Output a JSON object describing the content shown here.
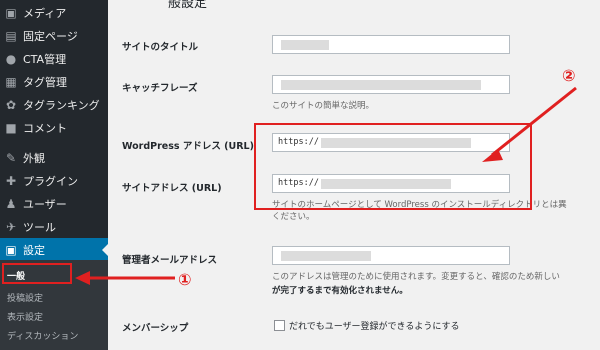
{
  "sidebar": {
    "items": [
      {
        "icon": "media-icon",
        "glyph": "▣",
        "label": "メディア"
      },
      {
        "icon": "page-icon",
        "glyph": "▤",
        "label": "固定ページ"
      },
      {
        "icon": "lightbulb-icon",
        "glyph": "●",
        "label": "CTA管理"
      },
      {
        "icon": "tag-icon",
        "glyph": "▦",
        "label": "タグ管理"
      },
      {
        "icon": "ranking-icon",
        "glyph": "✿",
        "label": "タグランキング"
      },
      {
        "icon": "comment-icon",
        "glyph": "■",
        "label": "コメント"
      },
      {
        "icon": "appearance-icon",
        "glyph": "✎",
        "label": "外観"
      },
      {
        "icon": "plugin-icon",
        "glyph": "✚",
        "label": "プラグイン"
      },
      {
        "icon": "users-icon",
        "glyph": "♟",
        "label": "ユーザー"
      },
      {
        "icon": "tools-icon",
        "glyph": "✈",
        "label": "ツール"
      },
      {
        "icon": "settings-icon",
        "glyph": "▣",
        "label": "設定"
      }
    ],
    "submenu": [
      {
        "label": "一般"
      },
      {
        "label": "投稿設定"
      },
      {
        "label": "表示設定"
      },
      {
        "label": "ディスカッション"
      }
    ]
  },
  "main": {
    "heading": "般設定",
    "site_title_label": "サイトのタイトル",
    "tagline_label": "キャッチフレーズ",
    "tagline_desc": "このサイトの簡単な説明。",
    "wp_address_label": "WordPress アドレス (URL)",
    "wp_address_value": "https://",
    "site_address_label": "サイトアドレス (URL)",
    "site_address_value": "https://",
    "site_address_desc_1": "サイトのホームページとして WordPress のインストールディレクトリとは異",
    "site_address_desc_2": "ください。",
    "admin_email_label": "管理者メールアドレス",
    "admin_email_desc_1": "このアドレスは管理のために使用されます。変更すると、確認のため新しい",
    "admin_email_desc_2": "が完了するまで有効化されません。",
    "membership_label": "メンバーシップ",
    "membership_checkbox": "だれでもユーザー登録ができるようにする"
  },
  "annotations": {
    "marker_1": "①",
    "marker_2": "②",
    "color": "#e02020"
  }
}
